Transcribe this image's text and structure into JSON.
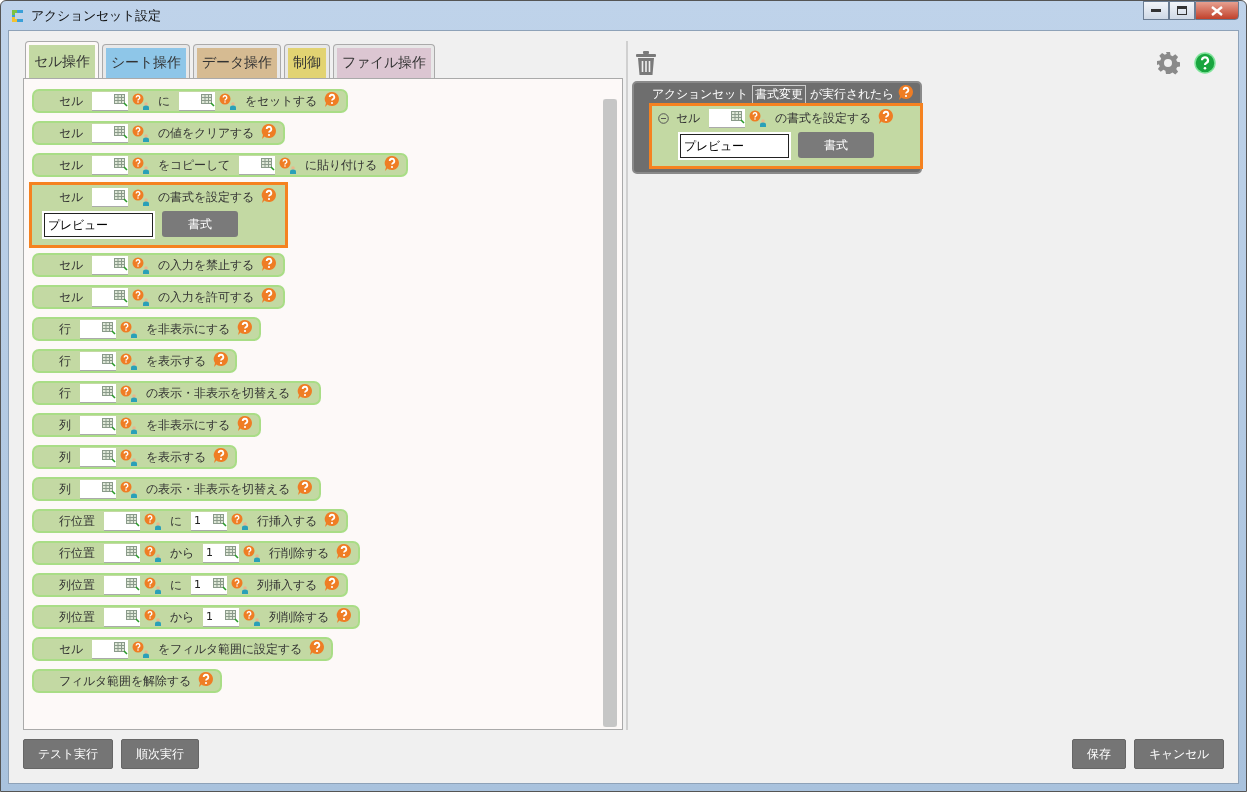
{
  "window": {
    "title": "アクションセット設定"
  },
  "tabs": [
    {
      "label": "セル操作",
      "selected": true,
      "color": "#c3d9a3"
    },
    {
      "label": "シート操作",
      "selected": false,
      "color": "#8ec6e8"
    },
    {
      "label": "データ操作",
      "selected": false,
      "color": "#d6bb92"
    },
    {
      "label": "制御",
      "selected": false,
      "color": "#e2d372"
    },
    {
      "label": "ファイル操作",
      "selected": false,
      "color": "#dcc6d2"
    }
  ],
  "blocks": [
    {
      "highlighted": false,
      "parts": [
        {
          "kind": "text",
          "text": "セル"
        },
        {
          "kind": "cell"
        },
        {
          "kind": "text",
          "text": "に"
        },
        {
          "kind": "cell"
        },
        {
          "kind": "text",
          "text": "をセットする"
        }
      ]
    },
    {
      "highlighted": false,
      "parts": [
        {
          "kind": "text",
          "text": "セル"
        },
        {
          "kind": "cell"
        },
        {
          "kind": "text",
          "text": "の値をクリアする"
        }
      ]
    },
    {
      "highlighted": false,
      "parts": [
        {
          "kind": "text",
          "text": "セル"
        },
        {
          "kind": "cell"
        },
        {
          "kind": "text",
          "text": "をコピーして"
        },
        {
          "kind": "cell"
        },
        {
          "kind": "text",
          "text": "に貼り付ける"
        }
      ]
    },
    {
      "highlighted": true,
      "parts": [
        {
          "kind": "text",
          "text": "セル"
        },
        {
          "kind": "cell"
        },
        {
          "kind": "text",
          "text": "の書式を設定する"
        }
      ],
      "preview": {
        "value": "プレビュー",
        "button": "書式"
      }
    },
    {
      "highlighted": false,
      "parts": [
        {
          "kind": "text",
          "text": "セル"
        },
        {
          "kind": "cell"
        },
        {
          "kind": "text",
          "text": "の入力を禁止する"
        }
      ]
    },
    {
      "highlighted": false,
      "parts": [
        {
          "kind": "text",
          "text": "セル"
        },
        {
          "kind": "cell"
        },
        {
          "kind": "text",
          "text": "の入力を許可する"
        }
      ]
    },
    {
      "highlighted": false,
      "parts": [
        {
          "kind": "text",
          "text": "行"
        },
        {
          "kind": "cell"
        },
        {
          "kind": "text",
          "text": "を非表示にする"
        }
      ]
    },
    {
      "highlighted": false,
      "parts": [
        {
          "kind": "text",
          "text": "行"
        },
        {
          "kind": "cell"
        },
        {
          "kind": "text",
          "text": "を表示する"
        }
      ]
    },
    {
      "highlighted": false,
      "parts": [
        {
          "kind": "text",
          "text": "行"
        },
        {
          "kind": "cell"
        },
        {
          "kind": "text",
          "text": "の表示・非表示を切替える"
        }
      ]
    },
    {
      "highlighted": false,
      "parts": [
        {
          "kind": "text",
          "text": "列"
        },
        {
          "kind": "cell"
        },
        {
          "kind": "text",
          "text": "を非表示にする"
        }
      ]
    },
    {
      "highlighted": false,
      "parts": [
        {
          "kind": "text",
          "text": "列"
        },
        {
          "kind": "cell"
        },
        {
          "kind": "text",
          "text": "を表示する"
        }
      ]
    },
    {
      "highlighted": false,
      "parts": [
        {
          "kind": "text",
          "text": "列"
        },
        {
          "kind": "cell"
        },
        {
          "kind": "text",
          "text": "の表示・非表示を切替える"
        }
      ]
    },
    {
      "highlighted": false,
      "parts": [
        {
          "kind": "text",
          "text": "行位置"
        },
        {
          "kind": "cell"
        },
        {
          "kind": "text",
          "text": "に"
        },
        {
          "kind": "cell",
          "value": "1"
        },
        {
          "kind": "text",
          "text": "行挿入する"
        }
      ]
    },
    {
      "highlighted": false,
      "parts": [
        {
          "kind": "text",
          "text": "行位置"
        },
        {
          "kind": "cell"
        },
        {
          "kind": "text",
          "text": "から"
        },
        {
          "kind": "cell",
          "value": "1"
        },
        {
          "kind": "text",
          "text": "行削除する"
        }
      ]
    },
    {
      "highlighted": false,
      "parts": [
        {
          "kind": "text",
          "text": "列位置"
        },
        {
          "kind": "cell"
        },
        {
          "kind": "text",
          "text": "に"
        },
        {
          "kind": "cell",
          "value": "1"
        },
        {
          "kind": "text",
          "text": "列挿入する"
        }
      ]
    },
    {
      "highlighted": false,
      "parts": [
        {
          "kind": "text",
          "text": "列位置"
        },
        {
          "kind": "cell"
        },
        {
          "kind": "text",
          "text": "から"
        },
        {
          "kind": "cell",
          "value": "1"
        },
        {
          "kind": "text",
          "text": "列削除する"
        }
      ]
    },
    {
      "highlighted": false,
      "parts": [
        {
          "kind": "text",
          "text": "セル"
        },
        {
          "kind": "cell"
        },
        {
          "kind": "text",
          "text": "をフィルタ範囲に設定する"
        }
      ]
    },
    {
      "highlighted": false,
      "parts": [
        {
          "kind": "text",
          "text": "フィルタ範囲を解除する"
        }
      ]
    }
  ],
  "action_set": {
    "label": "アクションセット",
    "name": "書式変更",
    "trigger": "が実行されたら",
    "block": {
      "highlighted": true,
      "expanded": true,
      "parts": [
        {
          "kind": "text",
          "text": "セル"
        },
        {
          "kind": "cell"
        },
        {
          "kind": "text",
          "text": "の書式を設定する"
        }
      ],
      "preview": {
        "value": "プレビュー",
        "button": "書式"
      }
    }
  },
  "buttons_left": [
    "テスト実行",
    "順次実行"
  ],
  "buttons_right": [
    "保存",
    "キャンセル"
  ]
}
